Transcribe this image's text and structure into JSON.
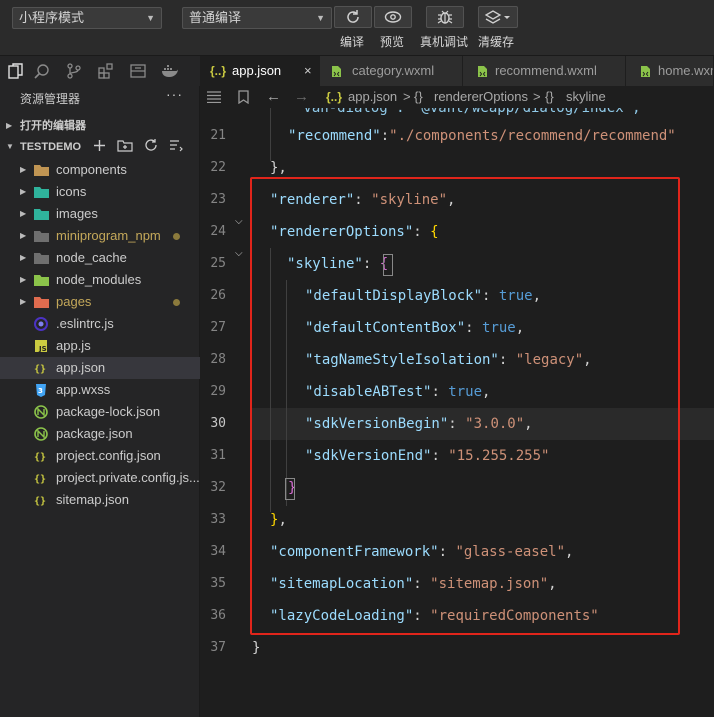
{
  "toolbar": {
    "mode_select": "小程序模式",
    "compile_select": "普通编译",
    "labels": {
      "compile": "编译",
      "preview": "预览",
      "remote_debug": "真机调试",
      "clear_cache": "清缓存"
    }
  },
  "sidebar": {
    "title": "资源管理器",
    "more": "···",
    "open_editors": "打开的编辑器",
    "project": "TESTDEMO",
    "items": [
      {
        "name": "components",
        "icon": "folder-icon",
        "color": "#c09553",
        "folder": true,
        "modified": false
      },
      {
        "name": "icons",
        "icon": "folder-icon",
        "color": "#2fb39c",
        "folder": true,
        "modified": false
      },
      {
        "name": "images",
        "icon": "folder-icon",
        "color": "#2fb39c",
        "folder": true,
        "modified": false
      },
      {
        "name": "miniprogram_npm",
        "icon": "folder-icon",
        "color": "#6f6f6f",
        "folder": true,
        "modified": true
      },
      {
        "name": "node_cache",
        "icon": "folder-icon",
        "color": "#6f6f6f",
        "folder": true,
        "modified": false
      },
      {
        "name": "node_modules",
        "icon": "folder-icon",
        "color": "#8bc34a",
        "folder": true,
        "modified": false
      },
      {
        "name": "pages",
        "icon": "folder-icon",
        "color": "#e06c4f",
        "folder": true,
        "modified": true
      },
      {
        "name": ".eslintrc.js",
        "icon": "eslint-icon",
        "color": "#4b32c3",
        "folder": false,
        "modified": false
      },
      {
        "name": "app.js",
        "icon": "js-icon",
        "color": "#cbcb41",
        "folder": false,
        "modified": false
      },
      {
        "name": "app.json",
        "icon": "json-icon",
        "color": "#cbcb41",
        "folder": false,
        "modified": false,
        "selected": true
      },
      {
        "name": "app.wxss",
        "icon": "css-icon",
        "color": "#42a5f5",
        "folder": false,
        "modified": false
      },
      {
        "name": "package-lock.json",
        "icon": "npm-icon",
        "color": "#8bc34a",
        "folder": false,
        "modified": false
      },
      {
        "name": "package.json",
        "icon": "npm-icon",
        "color": "#8bc34a",
        "folder": false,
        "modified": false
      },
      {
        "name": "project.config.json",
        "icon": "json-icon",
        "color": "#cbcb41",
        "folder": false,
        "modified": false
      },
      {
        "name": "project.private.config.js...",
        "icon": "json-icon",
        "color": "#cbcb41",
        "folder": false,
        "modified": false
      },
      {
        "name": "sitemap.json",
        "icon": "json-icon",
        "color": "#cbcb41",
        "folder": false,
        "modified": false
      }
    ]
  },
  "tabs": [
    {
      "label": "app.json",
      "icon": "{..}",
      "icon_color": "#cbcb41",
      "active": true,
      "close": "×"
    },
    {
      "label": "category.wxml",
      "icon": "wxml",
      "icon_color": "#8bc34a",
      "active": false
    },
    {
      "label": "recommend.wxml",
      "icon": "wxml",
      "icon_color": "#8bc34a",
      "active": false
    },
    {
      "label": "home.wxml",
      "icon": "wxml",
      "icon_color": "#8bc34a",
      "active": false
    }
  ],
  "breadcrumb": {
    "file": "app.json",
    "sep1": ">",
    "node1": "rendererOptions",
    "sep2": ">",
    "node2": "skyline"
  },
  "editor": {
    "current_line": 30,
    "lines": [
      {
        "n": "",
        "tokens": []
      },
      {
        "n": "21",
        "tokens": [
          [
            "k",
            "\"recommend\""
          ],
          [
            "p",
            ":"
          ],
          [
            "s",
            "\"./components/recommend/recommend\""
          ]
        ]
      },
      {
        "n": "22",
        "tokens": [
          [
            "p",
            "},"
          ]
        ]
      },
      {
        "n": "23",
        "tokens": [
          [
            "k",
            "\"renderer\""
          ],
          [
            "p",
            ": "
          ],
          [
            "s",
            "\"skyline\""
          ],
          [
            "p",
            ","
          ]
        ]
      },
      {
        "n": "24",
        "tokens": [
          [
            "k",
            "\"rendererOptions\""
          ],
          [
            "p",
            ": "
          ],
          [
            "gold",
            "{"
          ]
        ]
      },
      {
        "n": "25",
        "tokens": [
          [
            "k",
            "\"skyline\""
          ],
          [
            "p",
            ": "
          ],
          [
            "pink",
            "{"
          ]
        ]
      },
      {
        "n": "26",
        "tokens": [
          [
            "k",
            "\"defaultDisplayBlock\""
          ],
          [
            "p",
            ": "
          ],
          [
            "b",
            "true"
          ],
          [
            "p",
            ","
          ]
        ]
      },
      {
        "n": "27",
        "tokens": [
          [
            "k",
            "\"defaultContentBox\""
          ],
          [
            "p",
            ": "
          ],
          [
            "b",
            "true"
          ],
          [
            "p",
            ","
          ]
        ]
      },
      {
        "n": "28",
        "tokens": [
          [
            "k",
            "\"tagNameStyleIsolation\""
          ],
          [
            "p",
            ": "
          ],
          [
            "s",
            "\"legacy\""
          ],
          [
            "p",
            ","
          ]
        ]
      },
      {
        "n": "29",
        "tokens": [
          [
            "k",
            "\"disableABTest\""
          ],
          [
            "p",
            ": "
          ],
          [
            "b",
            "true"
          ],
          [
            "p",
            ","
          ]
        ]
      },
      {
        "n": "30",
        "tokens": [
          [
            "k",
            "\"sdkVersionBegin\""
          ],
          [
            "p",
            ": "
          ],
          [
            "s",
            "\"3.0.0\""
          ],
          [
            "p",
            ","
          ]
        ]
      },
      {
        "n": "31",
        "tokens": [
          [
            "k",
            "\"sdkVersionEnd\""
          ],
          [
            "p",
            ": "
          ],
          [
            "s",
            "\"15.255.255\""
          ]
        ]
      },
      {
        "n": "32",
        "tokens": [
          [
            "pink",
            "}"
          ]
        ]
      },
      {
        "n": "33",
        "tokens": [
          [
            "gold",
            "}"
          ],
          [
            "p",
            ","
          ]
        ]
      },
      {
        "n": "34",
        "tokens": [
          [
            "k",
            "\"componentFramework\""
          ],
          [
            "p",
            ": "
          ],
          [
            "s",
            "\"glass-easel\""
          ],
          [
            "p",
            ","
          ]
        ]
      },
      {
        "n": "35",
        "tokens": [
          [
            "k",
            "\"sitemapLocation\""
          ],
          [
            "p",
            ": "
          ],
          [
            "s",
            "\"sitemap.json\""
          ],
          [
            "p",
            ","
          ]
        ]
      },
      {
        "n": "36",
        "tokens": [
          [
            "k",
            "\"lazyCodeLoading\""
          ],
          [
            "p",
            ": "
          ],
          [
            "s",
            "\"requiredComponents\""
          ]
        ]
      },
      {
        "n": "37",
        "tokens": [
          [
            "p",
            "}"
          ]
        ]
      }
    ],
    "partial_top_line": "\"van-dialog\": \"@vant/weapp/dialog/index\","
  },
  "colors": {
    "highlight_box": "#e1251b",
    "editor_bg": "#1e1e1e",
    "sidebar_bg": "#252526"
  }
}
